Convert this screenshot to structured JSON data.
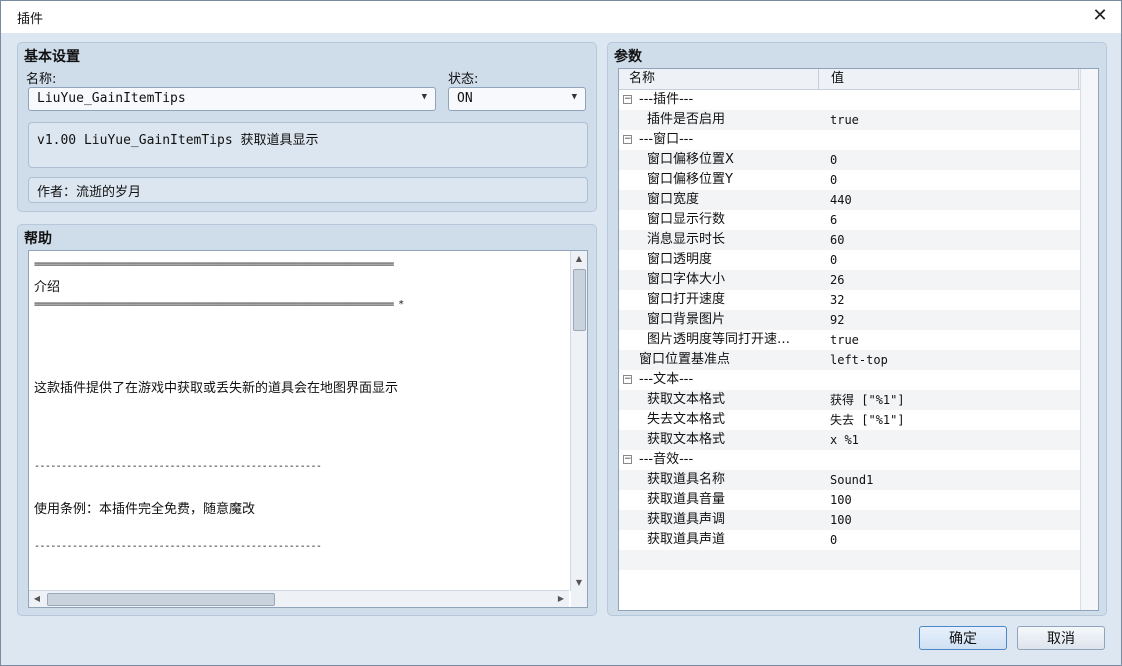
{
  "window": {
    "title": "插件",
    "close_glyph": "✕"
  },
  "basic": {
    "title": "基本设置",
    "name_label": "名称:",
    "name_value": "LiuYue_GainItemTips",
    "status_label": "状态:",
    "status_value": "ON",
    "description": "v1.00 LiuYue_GainItemTips 获取道具显示",
    "author": "作者：流逝的岁月"
  },
  "help": {
    "title": "帮助",
    "separator_eq": "=========================================================================",
    "separator_eq_star": "========================================================================= *",
    "intro": "介绍",
    "desc": "这款插件提供了在游戏中获取或丢失新的道具会在地图界面显示",
    "separator_dash": "-----------------------------------------------------",
    "terms": "使用条例：本插件完全免费，随意魔改"
  },
  "params": {
    "title": "参数",
    "col_name": "名称",
    "col_value": "值",
    "rows": [
      {
        "name": "---插件---",
        "value": "",
        "group": true
      },
      {
        "name": "插件是否启用",
        "value": "true"
      },
      {
        "name": "---窗口---",
        "value": "",
        "group": true
      },
      {
        "name": "窗口偏移位置X",
        "value": "0"
      },
      {
        "name": "窗口偏移位置Y",
        "value": "0"
      },
      {
        "name": "窗口宽度",
        "value": "440"
      },
      {
        "name": "窗口显示行数",
        "value": "6"
      },
      {
        "name": "消息显示时长",
        "value": "60"
      },
      {
        "name": "窗口透明度",
        "value": "0"
      },
      {
        "name": "窗口字体大小",
        "value": "26"
      },
      {
        "name": "窗口打开速度",
        "value": "32"
      },
      {
        "name": "窗口背景图片",
        "value": "92"
      },
      {
        "name": "图片透明度等同打开速…",
        "value": "true"
      },
      {
        "name": "窗口位置基准点",
        "value": "left-top",
        "shallow": true
      },
      {
        "name": "---文本---",
        "value": "",
        "group": true
      },
      {
        "name": "获取文本格式",
        "value": "获得 [\"%1\"]"
      },
      {
        "name": "失去文本格式",
        "value": "失去 [\"%1\"]"
      },
      {
        "name": "获取文本格式",
        "value": "x %1"
      },
      {
        "name": "---音效---",
        "value": "",
        "group": true
      },
      {
        "name": "获取道具名称",
        "value": "Sound1"
      },
      {
        "name": "获取道具音量",
        "value": "100"
      },
      {
        "name": "获取道具声调",
        "value": "100"
      },
      {
        "name": "获取道具声道",
        "value": "0"
      }
    ]
  },
  "buttons": {
    "ok": "确定",
    "cancel": "取消"
  }
}
